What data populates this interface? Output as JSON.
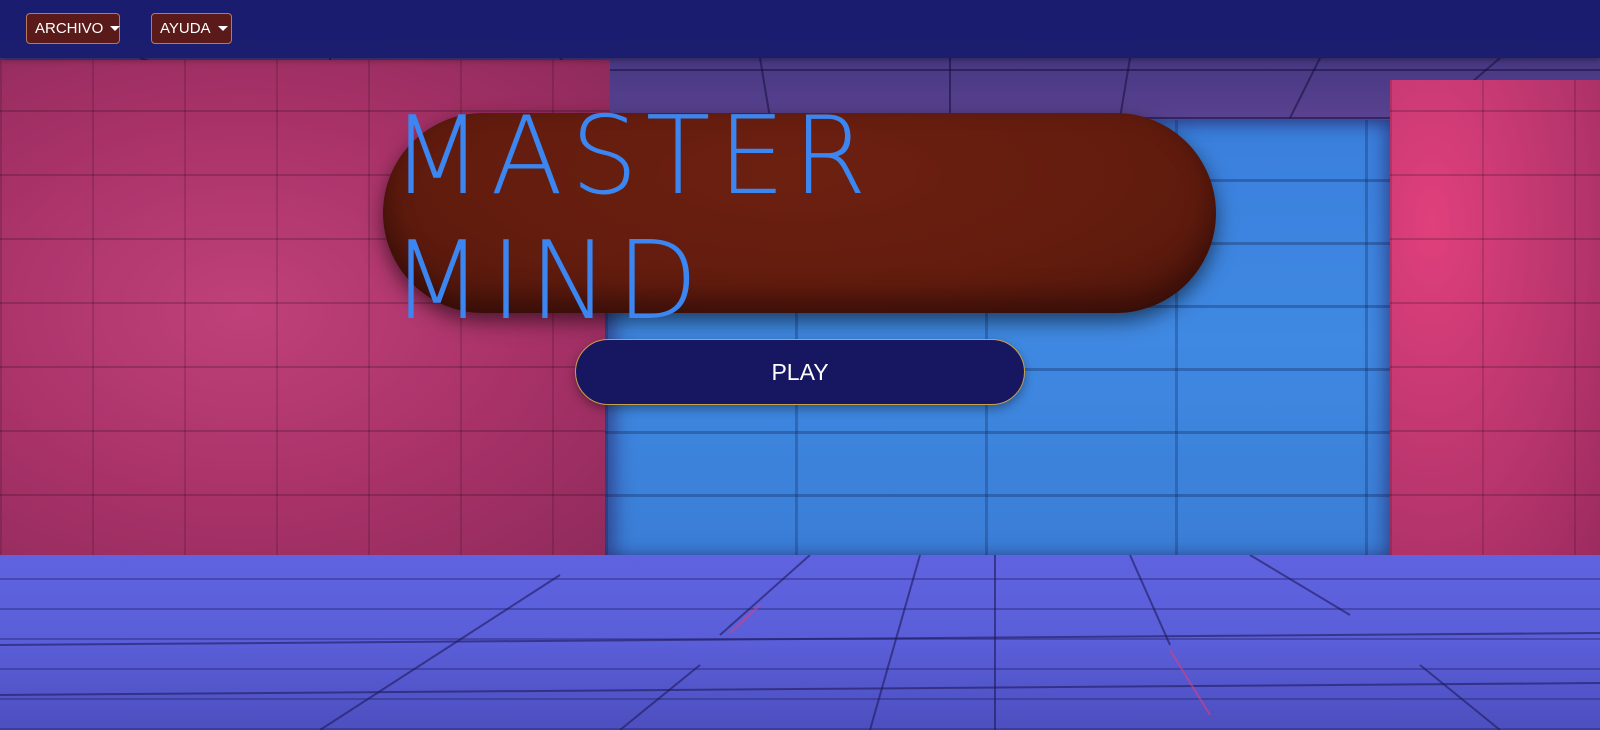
{
  "navbar": {
    "menus": [
      {
        "label": "ARCHIVO"
      },
      {
        "label": "AYUDA"
      }
    ]
  },
  "title": {
    "text": "MASTER MIND"
  },
  "play_button": {
    "label": "PLAY"
  },
  "colors": {
    "navbar_bg": "#181c6e",
    "menu_button_bg": "#5a1a1a",
    "title_pill_bg": "#621c0e",
    "title_text": "#3b86f0",
    "play_button_bg": "#171660",
    "play_button_border": "#c9a04a"
  },
  "icons": [
    "caret-down-icon"
  ]
}
